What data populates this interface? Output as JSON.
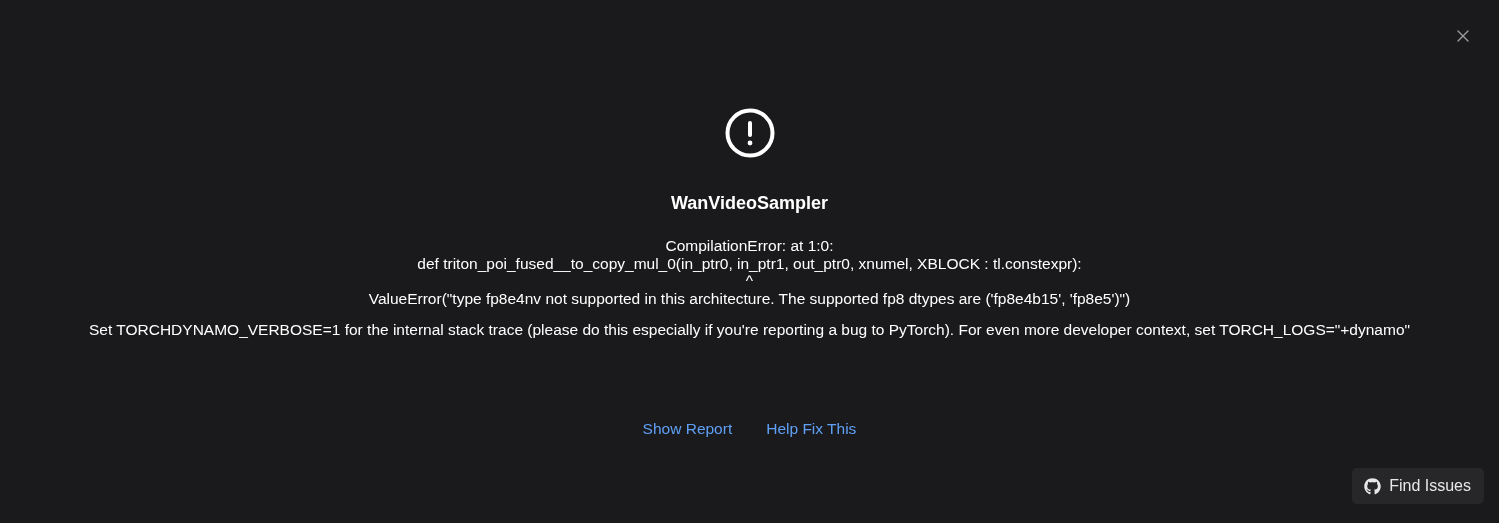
{
  "dialog": {
    "title": "WanVideoSampler",
    "message_lines": [
      "CompilationError: at 1:0:",
      "def triton_poi_fused__to_copy_mul_0(in_ptr0, in_ptr1, out_ptr0, xnumel, XBLOCK : tl.constexpr):",
      "^",
      "ValueError(\"type fp8e4nv not supported in this architecture. The supported fp8 dtypes are ('fp8e4b15', 'fp8e5')\")"
    ],
    "hint": "Set TORCHDYNAMO_VERBOSE=1 for the internal stack trace (please do this especially if you're reporting a bug to PyTorch). For even more developer context, set TORCH_LOGS=\"+dynamo\"",
    "links": [
      "Show Report",
      "Help Fix This"
    ],
    "find_issues_button": "Find Issues"
  }
}
